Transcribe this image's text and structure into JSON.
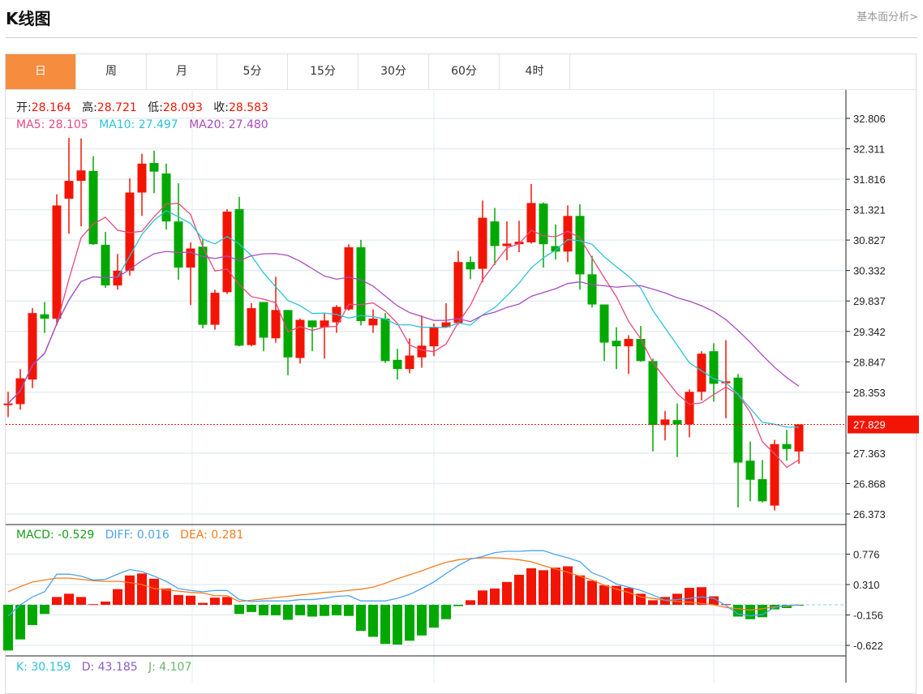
{
  "header": {
    "title": "K线图",
    "link": "基本面分析>"
  },
  "tabs": [
    {
      "label": "日",
      "active": true
    },
    {
      "label": "周"
    },
    {
      "label": "月"
    },
    {
      "label": "5分"
    },
    {
      "label": "15分"
    },
    {
      "label": "30分"
    },
    {
      "label": "60分"
    },
    {
      "label": "4时"
    }
  ],
  "ohlc_legend": {
    "open_label": "开:",
    "open": "28.164",
    "high_label": "高:",
    "high": "28.721",
    "low_label": "低:",
    "low": "28.093",
    "close_label": "收:",
    "close": "28.583"
  },
  "ma_legend": {
    "ma5": "MA5: 28.105",
    "ma10": "MA10: 27.497",
    "ma20": "MA20: 27.480"
  },
  "macd_legend": {
    "macd": "MACD: -0.529",
    "diff": "DIFF: 0.016",
    "dea": "DEA: 0.281"
  },
  "kdj_legend": {
    "k": "K: 30.159",
    "d": "D: 43.185",
    "j": "J: 4.107"
  },
  "colors": {
    "up": "#f21505",
    "down": "#00a800",
    "ma5": "#e84a7f",
    "ma10": "#2bc4d8",
    "ma20": "#a94cc0",
    "diff": "#4da3f0",
    "dea": "#f57c1f",
    "accent": "#f58c3e"
  },
  "chart_data": [
    {
      "type": "candlestick",
      "title": "K线图",
      "price_ticks": [
        "32.806",
        "32.311",
        "31.816",
        "31.321",
        "30.827",
        "30.332",
        "29.837",
        "29.342",
        "28.847",
        "28.353",
        "27.363",
        "26.868",
        "26.373"
      ],
      "ylim": [
        26.373,
        32.806
      ],
      "current_price": "27.829",
      "ohlc": [
        [
          28.17,
          28.36,
          27.95,
          28.17
        ],
        [
          28.16,
          28.73,
          28.07,
          28.58
        ],
        [
          28.56,
          29.72,
          28.42,
          29.64
        ],
        [
          29.62,
          29.82,
          29.32,
          29.55
        ],
        [
          29.55,
          31.57,
          29.44,
          31.39
        ],
        [
          31.5,
          32.49,
          30.93,
          31.79
        ],
        [
          31.79,
          32.48,
          31.05,
          31.96
        ],
        [
          31.95,
          32.19,
          30.75,
          30.76
        ],
        [
          30.75,
          30.96,
          30.05,
          30.09
        ],
        [
          30.09,
          30.6,
          30.02,
          30.33
        ],
        [
          30.33,
          31.83,
          30.25,
          31.6
        ],
        [
          31.6,
          32.23,
          31.22,
          32.07
        ],
        [
          32.08,
          32.28,
          31.59,
          31.94
        ],
        [
          31.91,
          32.07,
          31.0,
          31.13
        ],
        [
          31.13,
          31.75,
          30.18,
          30.38
        ],
        [
          30.38,
          30.79,
          29.77,
          30.69
        ],
        [
          30.72,
          30.84,
          29.39,
          29.45
        ],
        [
          29.45,
          30.02,
          29.37,
          29.97
        ],
        [
          29.98,
          31.33,
          29.95,
          31.29
        ],
        [
          31.33,
          31.53,
          29.1,
          29.11
        ],
        [
          29.12,
          29.8,
          29.1,
          29.72
        ],
        [
          29.82,
          29.82,
          29.02,
          29.24
        ],
        [
          29.23,
          30.23,
          29.16,
          29.69
        ],
        [
          29.69,
          29.69,
          28.63,
          28.92
        ],
        [
          28.91,
          29.55,
          28.82,
          29.53
        ],
        [
          29.52,
          29.52,
          29.02,
          29.41
        ],
        [
          29.41,
          29.64,
          28.9,
          29.52
        ],
        [
          29.49,
          29.77,
          29.32,
          29.74
        ],
        [
          29.7,
          30.76,
          29.68,
          30.71
        ],
        [
          30.71,
          30.83,
          29.44,
          29.51
        ],
        [
          29.44,
          29.7,
          29.32,
          29.55
        ],
        [
          29.55,
          29.64,
          28.83,
          28.86
        ],
        [
          28.88,
          29.06,
          28.56,
          28.73
        ],
        [
          28.73,
          29.23,
          28.66,
          28.95
        ],
        [
          28.92,
          29.6,
          28.75,
          29.11
        ],
        [
          29.1,
          29.47,
          28.94,
          29.41
        ],
        [
          29.41,
          29.8,
          29.4,
          29.49
        ],
        [
          29.48,
          30.65,
          29.45,
          30.47
        ],
        [
          30.47,
          30.56,
          30.19,
          30.35
        ],
        [
          30.36,
          31.47,
          30.14,
          31.19
        ],
        [
          31.13,
          31.35,
          30.42,
          30.73
        ],
        [
          30.73,
          31.13,
          30.5,
          30.77
        ],
        [
          30.76,
          31.14,
          30.63,
          30.8
        ],
        [
          30.79,
          31.74,
          30.77,
          31.43
        ],
        [
          31.42,
          31.44,
          30.38,
          30.76
        ],
        [
          30.73,
          31.08,
          30.51,
          30.64
        ],
        [
          30.64,
          31.39,
          30.47,
          31.22
        ],
        [
          31.22,
          31.41,
          30.02,
          30.27
        ],
        [
          30.27,
          30.57,
          29.73,
          29.78
        ],
        [
          29.78,
          29.78,
          28.86,
          29.16
        ],
        [
          29.19,
          29.41,
          28.73,
          29.1
        ],
        [
          29.1,
          29.28,
          28.65,
          29.22
        ],
        [
          29.22,
          29.43,
          28.85,
          28.86
        ],
        [
          28.86,
          28.9,
          27.39,
          27.82
        ],
        [
          27.82,
          28.05,
          27.57,
          27.91
        ],
        [
          27.9,
          28.17,
          27.3,
          27.83
        ],
        [
          27.83,
          28.4,
          27.62,
          28.36
        ],
        [
          28.36,
          29.02,
          28.22,
          28.98
        ],
        [
          29.02,
          29.15,
          28.2,
          28.49
        ],
        [
          28.5,
          29.2,
          27.93,
          28.53
        ],
        [
          28.59,
          28.65,
          26.48,
          27.21
        ],
        [
          27.24,
          27.55,
          26.58,
          26.93
        ],
        [
          26.94,
          27.25,
          26.56,
          26.58
        ],
        [
          26.51,
          27.58,
          26.43,
          27.51
        ],
        [
          27.51,
          27.74,
          27.24,
          27.43
        ],
        [
          27.39,
          27.83,
          27.19,
          27.83
        ]
      ],
      "series": [
        "MA5",
        "MA10",
        "MA20"
      ]
    },
    {
      "type": "bar",
      "title": "MACD",
      "ticks": [
        "0.776",
        "0.310",
        "-0.156",
        "-0.622"
      ],
      "ylim": [
        -0.72,
        1.2
      ],
      "macd": [
        -0.7,
        -0.53,
        -0.31,
        -0.14,
        0.12,
        0.17,
        0.12,
        0.01,
        0.05,
        0.24,
        0.45,
        0.48,
        0.4,
        0.25,
        0.15,
        0.14,
        0.03,
        0.11,
        0.12,
        -0.14,
        -0.11,
        -0.16,
        -0.16,
        -0.23,
        -0.16,
        -0.18,
        -0.17,
        -0.16,
        -0.17,
        -0.4,
        -0.49,
        -0.6,
        -0.61,
        -0.55,
        -0.47,
        -0.35,
        -0.22,
        -0.02,
        0.07,
        0.22,
        0.25,
        0.35,
        0.46,
        0.56,
        0.53,
        0.57,
        0.59,
        0.45,
        0.37,
        0.3,
        0.29,
        0.26,
        0.17,
        0.07,
        0.12,
        0.17,
        0.26,
        0.27,
        0.13,
        0.01,
        -0.18,
        -0.22,
        -0.19,
        -0.07,
        -0.05,
        -0.01
      ],
      "diff": [
        -0.17,
        0.0,
        0.12,
        0.2,
        0.47,
        0.47,
        0.44,
        0.38,
        0.39,
        0.47,
        0.54,
        0.51,
        0.44,
        0.36,
        0.25,
        0.22,
        0.2,
        0.22,
        0.22,
        0.08,
        0.05,
        0.06,
        0.06,
        0.06,
        0.08,
        0.08,
        0.1,
        0.13,
        0.14,
        0.06,
        0.06,
        0.06,
        0.1,
        0.16,
        0.25,
        0.35,
        0.48,
        0.6,
        0.7,
        0.74,
        0.8,
        0.82,
        0.82,
        0.83,
        0.83,
        0.77,
        0.72,
        0.66,
        0.49,
        0.42,
        0.32,
        0.27,
        0.22,
        0.15,
        0.07,
        0.08,
        0.1,
        0.12,
        0.1,
        -0.01,
        -0.14,
        -0.17,
        -0.15,
        -0.04,
        -0.01,
        0.0
      ],
      "dea": [
        0.2,
        0.28,
        0.35,
        0.38,
        0.41,
        0.41,
        0.39,
        0.37,
        0.36,
        0.36,
        0.34,
        0.31,
        0.25,
        0.23,
        0.21,
        0.19,
        0.18,
        0.14,
        0.14,
        0.05,
        0.07,
        0.09,
        0.11,
        0.13,
        0.15,
        0.17,
        0.19,
        0.2,
        0.22,
        0.24,
        0.27,
        0.33,
        0.4,
        0.46,
        0.52,
        0.59,
        0.65,
        0.69,
        0.71,
        0.72,
        0.72,
        0.71,
        0.69,
        0.66,
        0.6,
        0.55,
        0.5,
        0.44,
        0.38,
        0.3,
        0.24,
        0.19,
        0.12,
        0.1,
        0.07,
        0.05,
        0.04,
        0.02,
        0.0,
        -0.04,
        -0.06,
        -0.08,
        -0.06,
        -0.03,
        -0.02,
        0.0
      ]
    }
  ]
}
